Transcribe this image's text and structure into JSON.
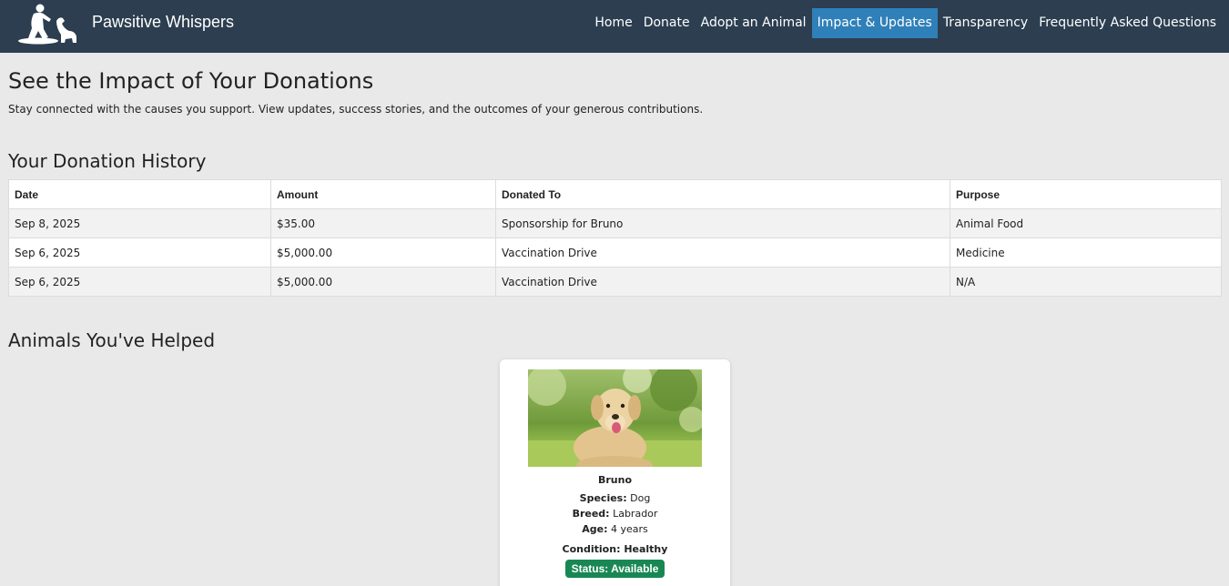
{
  "header": {
    "brand": "Pawsitive Whispers",
    "logo_icon": "person-with-dog-logo",
    "bg_color": "#2c3e50",
    "nav": [
      {
        "label": "Home",
        "active": false
      },
      {
        "label": "Donate",
        "active": false
      },
      {
        "label": "Adopt an Animal",
        "active": false
      },
      {
        "label": "Impact & Updates",
        "active": true
      },
      {
        "label": "Transparency",
        "active": false
      },
      {
        "label": "Frequently Asked Questions",
        "active": false
      }
    ],
    "active_color": "#2f80b9"
  },
  "page": {
    "title": "See the Impact of Your Donations",
    "subtitle": "Stay connected with the causes you support. View updates, success stories, and the outcomes of your generous contributions."
  },
  "history": {
    "title": "Your Donation History",
    "columns": [
      "Date",
      "Amount",
      "Donated To",
      "Purpose"
    ],
    "rows": [
      [
        "Sep 8, 2025",
        "$35.00",
        "Sponsorship for Bruno",
        "Animal Food"
      ],
      [
        "Sep 6, 2025",
        "$5,000.00",
        "Vaccination Drive",
        "Medicine"
      ],
      [
        "Sep 6, 2025",
        "$5,000.00",
        "Vaccination Drive",
        "N/A"
      ]
    ]
  },
  "helped": {
    "title": "Animals You've Helped",
    "animals": [
      {
        "name": "Bruno",
        "species_label": "Species:",
        "species": "Dog",
        "breed_label": "Breed:",
        "breed": "Labrador",
        "age_label": "Age:",
        "age": "4 years",
        "condition_label": "Condition:",
        "condition": "Healthy",
        "status_label": "Status:",
        "status": "Available",
        "status_color": "#198754",
        "photo": "labrador-dog-photo"
      }
    ]
  }
}
